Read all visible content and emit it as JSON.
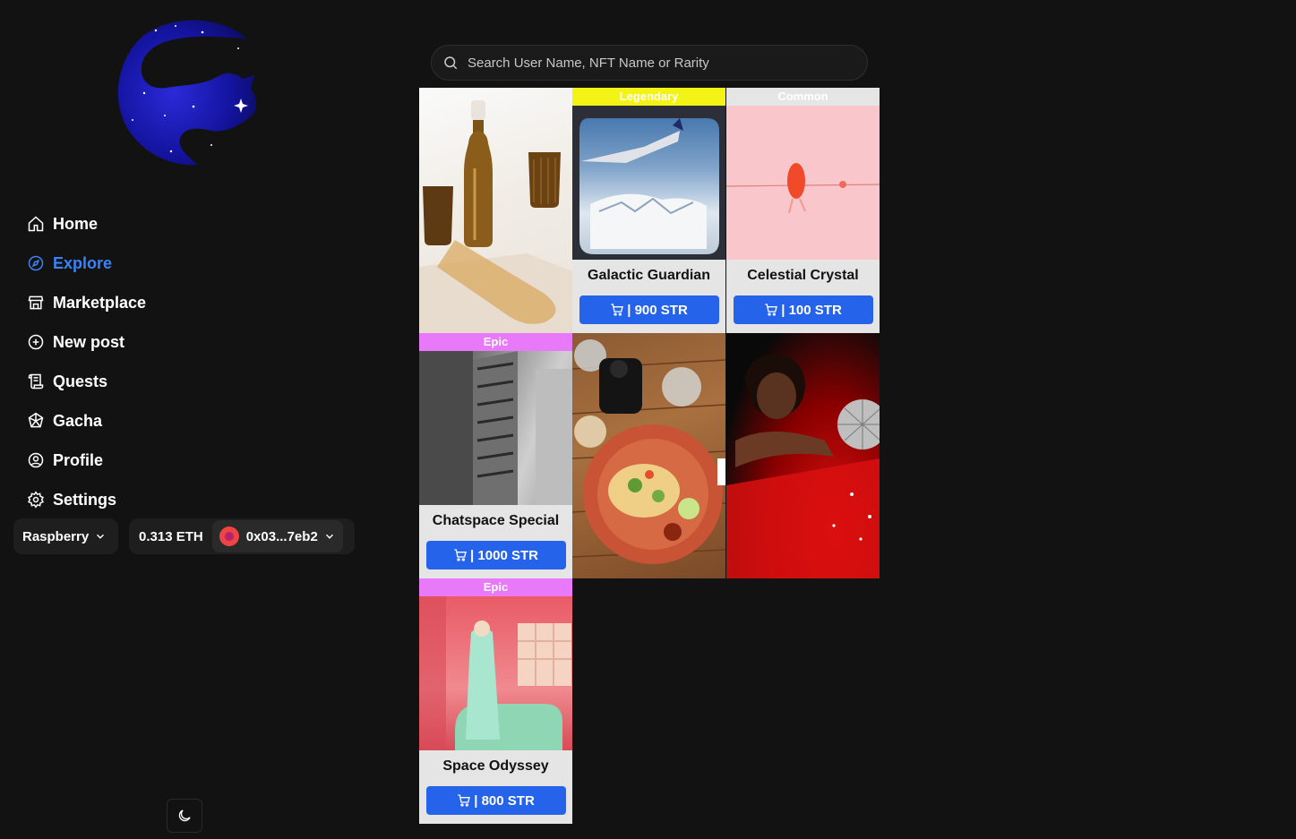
{
  "sidebar": {
    "items": [
      {
        "label": "Home",
        "icon": "home-icon"
      },
      {
        "label": "Explore",
        "icon": "compass-icon",
        "active": true
      },
      {
        "label": "Marketplace",
        "icon": "store-icon"
      },
      {
        "label": "New post",
        "icon": "plus-circle-icon"
      },
      {
        "label": "Quests",
        "icon": "scroll-icon"
      },
      {
        "label": "Gacha",
        "icon": "gem-icon"
      },
      {
        "label": "Profile",
        "icon": "user-circle-icon"
      },
      {
        "label": "Settings",
        "icon": "gear-icon"
      }
    ],
    "theme_label": "Raspberry",
    "balance": "0.313 ETH",
    "address": "0x03...7eb2"
  },
  "search": {
    "placeholder": "Search User Name, NFT Name or Rarity"
  },
  "cards": [
    {
      "rarity": "",
      "name": "",
      "price": ""
    },
    {
      "rarity": "Legendary",
      "name": "Galactic Guardian",
      "price": "| 900 STR"
    },
    {
      "rarity": "Common",
      "name": "Celestial Crystal",
      "price": "| 100 STR"
    },
    {
      "rarity": "Epic",
      "name": "Chatspace Special",
      "price": "| 1000 STR"
    },
    {
      "rarity": "",
      "name": "",
      "price": ""
    },
    {
      "rarity": "",
      "name": "",
      "price": ""
    },
    {
      "rarity": "Epic",
      "name": "Space Odyssey",
      "price": "| 800 STR"
    }
  ],
  "colors": {
    "accent": "#2563eb",
    "active_nav": "#3b82f6",
    "legendary": "#f3f316",
    "common": "#e5e5e5",
    "epic": "#e879f9",
    "background": "#121212"
  }
}
